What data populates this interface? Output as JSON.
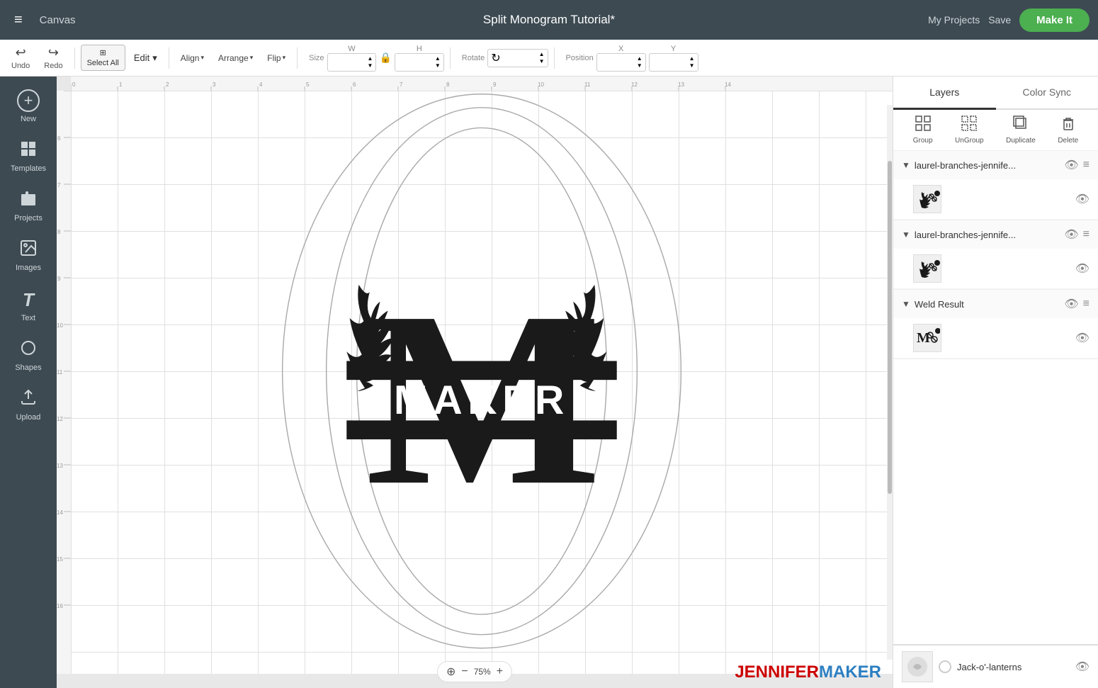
{
  "topbar": {
    "menu_label": "≡",
    "canvas_label": "Canvas",
    "title": "Split Monogram Tutorial*",
    "my_projects": "My Projects",
    "save": "Save",
    "make_it": "Make It"
  },
  "toolbar": {
    "undo_label": "Undo",
    "redo_label": "Redo",
    "select_all_label": "Select All",
    "edit_label": "Edit",
    "size_label": "Size",
    "w_label": "W",
    "h_label": "H",
    "rotate_label": "Rotate",
    "position_label": "Position",
    "x_label": "X",
    "y_label": "Y",
    "align_label": "Align",
    "arrange_label": "Arrange",
    "flip_label": "Flip"
  },
  "sidebar": {
    "items": [
      {
        "id": "new",
        "label": "New",
        "icon": "+"
      },
      {
        "id": "templates",
        "label": "Templates",
        "icon": "⊞"
      },
      {
        "id": "projects",
        "label": "Projects",
        "icon": "📁"
      },
      {
        "id": "images",
        "label": "Images",
        "icon": "🖼"
      },
      {
        "id": "text",
        "label": "Text",
        "icon": "T"
      },
      {
        "id": "shapes",
        "label": "Shapes",
        "icon": "◎"
      },
      {
        "id": "upload",
        "label": "Upload",
        "icon": "☁"
      }
    ]
  },
  "right_panel": {
    "tabs": [
      {
        "id": "layers",
        "label": "Layers",
        "active": true
      },
      {
        "id": "color_sync",
        "label": "Color Sync",
        "active": false
      }
    ],
    "actions": [
      {
        "id": "group",
        "label": "Group",
        "icon": "⊞",
        "disabled": false
      },
      {
        "id": "ungroup",
        "label": "UnGroup",
        "icon": "⊟",
        "disabled": false
      },
      {
        "id": "duplicate",
        "label": "Duplicate",
        "icon": "❐",
        "disabled": false
      },
      {
        "id": "delete",
        "label": "Delete",
        "icon": "🗑",
        "disabled": false
      }
    ],
    "layer_groups": [
      {
        "id": "lg1",
        "name": "laurel-branches-jennife...",
        "expanded": true,
        "items": [
          {
            "id": "li1",
            "has_thumb": true
          }
        ]
      },
      {
        "id": "lg2",
        "name": "laurel-branches-jennife...",
        "expanded": true,
        "items": [
          {
            "id": "li2",
            "has_thumb": true
          }
        ]
      },
      {
        "id": "lg3",
        "name": "Weld Result",
        "expanded": true,
        "items": [
          {
            "id": "li3",
            "has_thumb": true
          }
        ]
      }
    ],
    "bottom_layer": {
      "name": "Jack-o'-lanterns",
      "has_circle": true
    }
  },
  "canvas": {
    "zoom": "75%",
    "zoom_plus": "+",
    "zoom_minus": "−"
  },
  "watermark": {
    "jennifer": "JENNIFER",
    "maker": "MAKER"
  }
}
